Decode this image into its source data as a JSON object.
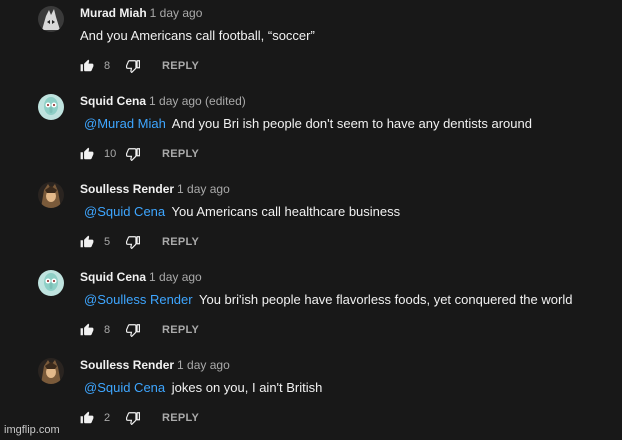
{
  "colors": {
    "background": "#181818",
    "text": "#f1f1f1",
    "muted": "#aaaaaa",
    "mention": "#3ea6ff"
  },
  "actions": {
    "reply_label": "REPLY"
  },
  "comments": [
    {
      "author": "Murad Miah",
      "time": "1 day ago",
      "mention": "",
      "text": "And you Americans call football, “soccer”",
      "likes": "8",
      "avatar_icon": "wolf-avatar-icon"
    },
    {
      "author": "Squid Cena",
      "time": "1 day ago (edited)",
      "mention": "@Murad Miah",
      "text": "And you Bri ish people don't seem to have any dentists around",
      "likes": "10",
      "avatar_icon": "squidward-avatar-icon"
    },
    {
      "author": "Soulless Render",
      "time": "1 day ago",
      "mention": "@Squid Cena",
      "text": "You Americans call healthcare business",
      "likes": "5",
      "avatar_icon": "character-avatar-icon"
    },
    {
      "author": "Squid Cena",
      "time": "1 day ago",
      "mention": "@Soulless Render",
      "text": "You bri'ish people have flavorless foods, yet conquered the world",
      "likes": "8",
      "avatar_icon": "squidward-avatar-icon"
    },
    {
      "author": "Soulless Render",
      "time": "1 day ago",
      "mention": "@Squid Cena",
      "text": "jokes on you, I ain't British",
      "likes": "2",
      "avatar_icon": "character-avatar-icon"
    }
  ],
  "watermark": "imgflip.com"
}
